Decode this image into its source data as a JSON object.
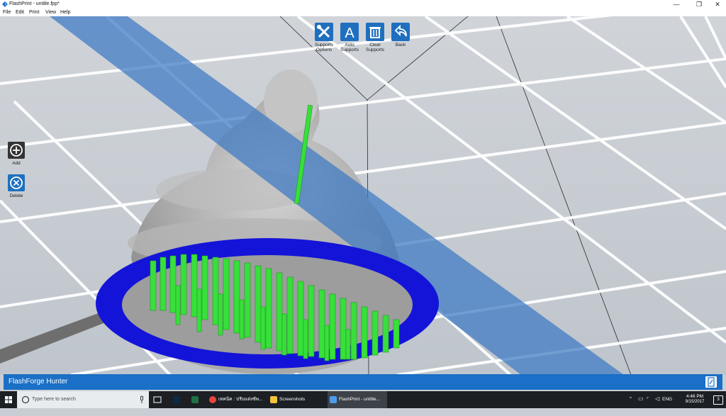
{
  "window": {
    "title": "FlashPrint - untitle.fpp*",
    "minimize": "—",
    "maximize": "❐",
    "close": "✕"
  },
  "menu": [
    "File",
    "Edit",
    "Print",
    "View",
    "Help"
  ],
  "toolbar": [
    {
      "id": "supports-options",
      "label": "Supports\nOptions",
      "icon": "wrench-screwdriver-icon"
    },
    {
      "id": "auto-supports",
      "label": "Auto\nSupports",
      "icon": "letter-a-icon"
    },
    {
      "id": "clear-supports",
      "label": "Clear\nSupports",
      "icon": "trash-icon"
    },
    {
      "id": "back",
      "label": "Back",
      "icon": "back-arrow-icon"
    }
  ],
  "side": {
    "add_label": "Add",
    "delete_label": "Delete"
  },
  "status": {
    "printer": "FlashForge Hunter"
  },
  "taskbar": {
    "search_placeholder": "Type here to search",
    "apps": [
      {
        "name": "chrome",
        "label": "เทคนิค : ปรับแต่งซัพ..."
      },
      {
        "name": "explorer",
        "label": "Screenshots"
      },
      {
        "name": "flashprint",
        "label": "FlashPrint - untitle..."
      }
    ],
    "language": "ENG",
    "time": "4:46 PM",
    "date": "9/15/2017",
    "notification_count": "3"
  },
  "colors": {
    "accent": "#1a6fc6",
    "support_green": "#37e03a",
    "raft_blue": "#1414d8",
    "model_gray": "#b9b9b9",
    "plane_blue": "#3b79c4"
  }
}
